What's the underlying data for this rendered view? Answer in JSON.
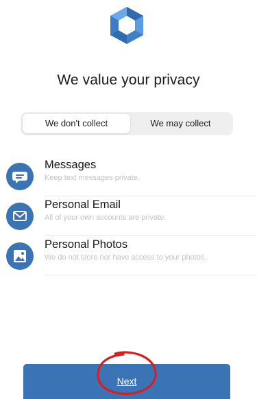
{
  "header": {
    "logo_icon": "hexagon-logo-icon",
    "title": "We value your privacy"
  },
  "tabs": [
    {
      "label": "We don't collect",
      "selected": true
    },
    {
      "label": "We may collect",
      "selected": false
    }
  ],
  "items": [
    {
      "icon": "message-bubble-icon",
      "name": "Messages",
      "description": "Keep text messages private."
    },
    {
      "icon": "envelope-icon",
      "name": "Personal Email",
      "description": "All of your own accounts are private."
    },
    {
      "icon": "photo-icon",
      "name": "Personal Photos",
      "description": "We do not store nor have access to your photos."
    }
  ],
  "footer": {
    "next_label": "Next"
  },
  "colors": {
    "accent": "#3a74b5",
    "logo_light": "#5b9be0",
    "logo_dark": "#2f6bb0",
    "annotation": "#e01b1b"
  }
}
